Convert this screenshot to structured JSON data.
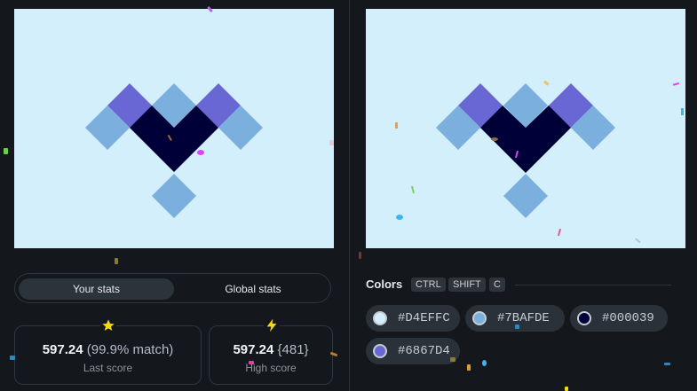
{
  "tabs": {
    "your_stats": "Your stats",
    "global_stats": "Global stats"
  },
  "stats": {
    "last": {
      "score": "597.24",
      "match": "(99.9% match)",
      "label": "Last score",
      "icon": "star-icon"
    },
    "high": {
      "score": "597.24",
      "rank": "{481}",
      "label": "High score",
      "icon": "lightning-icon"
    }
  },
  "colors_panel": {
    "title": "Colors",
    "shortcut": [
      "CTRL",
      "SHIFT",
      "C"
    ],
    "swatches": [
      {
        "hex": "#D4EFFC"
      },
      {
        "hex": "#7BAFDE"
      },
      {
        "hex": "#000039"
      },
      {
        "hex": "#6867D4"
      }
    ]
  },
  "palette": {
    "background": "#D4EFFC",
    "light": "#7BAFDE",
    "dark": "#000039",
    "purple": "#6867D4",
    "accent_star": "#f5d90a"
  }
}
